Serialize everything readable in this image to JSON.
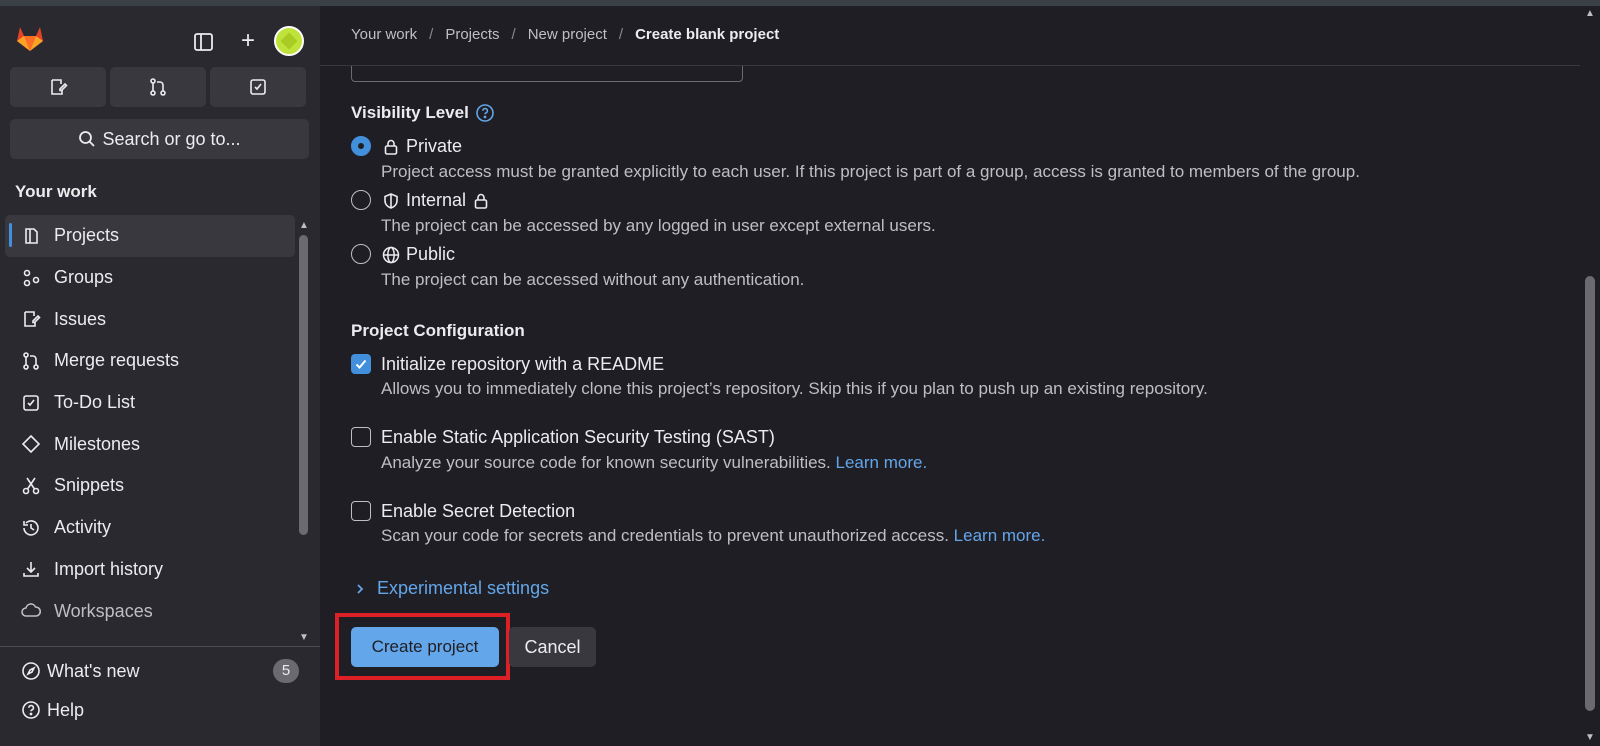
{
  "sidebar": {
    "section_title": "Your work",
    "search_label": "Search or go to...",
    "items": [
      {
        "label": "Projects",
        "icon": "project-icon"
      },
      {
        "label": "Groups",
        "icon": "group-icon"
      },
      {
        "label": "Issues",
        "icon": "issues-icon"
      },
      {
        "label": "Merge requests",
        "icon": "merge-request-icon"
      },
      {
        "label": "To-Do List",
        "icon": "todo-icon"
      },
      {
        "label": "Milestones",
        "icon": "milestone-icon"
      },
      {
        "label": "Snippets",
        "icon": "snippet-icon"
      },
      {
        "label": "Activity",
        "icon": "history-icon"
      },
      {
        "label": "Import history",
        "icon": "download-icon"
      },
      {
        "label": "Workspaces",
        "icon": "cloud-icon"
      }
    ],
    "footer": {
      "whats_new": "What's new",
      "whats_new_count": "5",
      "help": "Help"
    }
  },
  "breadcrumb": [
    "Your work",
    "Projects",
    "New project",
    "Create blank project"
  ],
  "visibility": {
    "title": "Visibility Level",
    "options": [
      {
        "label": "Private",
        "desc": "Project access must be granted explicitly to each user. If this project is part of a group, access is granted to members of the group.",
        "checked": true
      },
      {
        "label": "Internal",
        "desc": "The project can be accessed by any logged in user except external users.",
        "checked": false
      },
      {
        "label": "Public",
        "desc": "The project can be accessed without any authentication.",
        "checked": false
      }
    ]
  },
  "config": {
    "title": "Project Configuration",
    "options": [
      {
        "label": "Initialize repository with a README",
        "desc": "Allows you to immediately clone this project’s repository. Skip this if you plan to push up an existing repository.",
        "checked": true
      },
      {
        "label": "Enable Static Application Security Testing (SAST)",
        "desc": "Analyze your source code for known security vulnerabilities.",
        "link": "Learn more.",
        "checked": false
      },
      {
        "label": "Enable Secret Detection",
        "desc": "Scan your code for secrets and credentials to prevent unauthorized access.",
        "link": "Learn more.",
        "checked": false
      }
    ]
  },
  "experimental_label": "Experimental settings",
  "buttons": {
    "create": "Create project",
    "cancel": "Cancel"
  },
  "colors": {
    "accent": "#428fdc",
    "primary_button": "#63a6e9",
    "highlight": "#dd1f26"
  }
}
